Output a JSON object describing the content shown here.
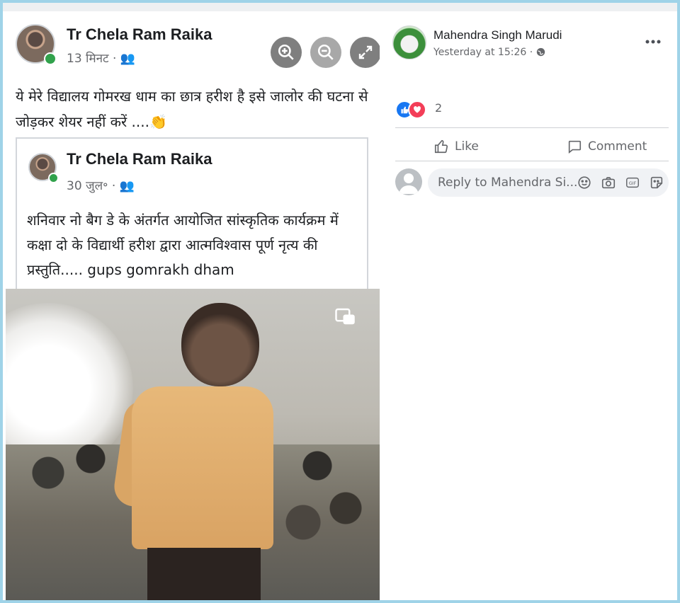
{
  "shared_image": {
    "author": "Tr Chela Ram Raika",
    "meta": "13 मिनट · 👥",
    "text": "ये मेरे विद्यालय गोमरख धाम का छात्र हरीश है इसे जालोर की घटना से जोड़कर शेयर नहीं करें ....👏",
    "zoom_controls": [
      "zoom-in-icon",
      "zoom-out-icon",
      "fullscreen-icon"
    ],
    "shared_post": {
      "author": "Tr Chela Ram Raika",
      "meta": "30 जुल॰ · 👥",
      "text": "शनिवार नो बैग डे के अंतर्गत आयोजित सांस्कृतिक कार्यक्रम में कक्षा दो के विद्यार्थी हरीश द्वारा आत्मविश्वास पूर्ण नृत्य की प्रस्तुति..... gups gomrakh dham"
    }
  },
  "comment_panel": {
    "poster_name": "Mahendra Singh Marudi",
    "poster_time": "Yesterday at 15:26 ·",
    "more_icon": "more-icon",
    "reaction_count": "2",
    "like_label": "Like",
    "comment_label": "Comment",
    "reply_placeholder": "Reply to Mahendra Si..."
  },
  "colors": {
    "like_blue": "#1877f2",
    "love_red": "#f33e58",
    "secondary_text": "#65676b",
    "online_green": "#31a24c"
  }
}
